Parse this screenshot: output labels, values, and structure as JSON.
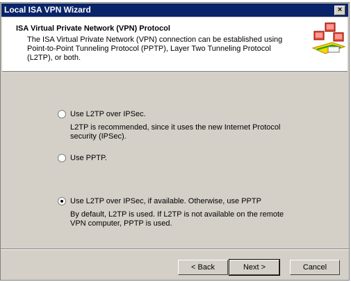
{
  "window": {
    "title": "Local ISA VPN Wizard",
    "close_glyph": "×"
  },
  "header": {
    "title": "ISA Virtual Private Network (VPN) Protocol",
    "description": "The ISA Virtual Private Network (VPN) connection can be established using Point-to-Point Tunneling Protocol (PPTP), Layer Two Tunneling Protocol (L2TP), or both.",
    "icon": "network-computers-icon"
  },
  "options": [
    {
      "label": "Use L2TP over IPSec.",
      "description": "L2TP is recommended, since it uses the new Internet Protocol security (IPSec).",
      "selected": false
    },
    {
      "label": "Use PPTP.",
      "description": "",
      "selected": false
    },
    {
      "label": "Use L2TP over IPSec, if available. Otherwise, use PPTP",
      "description": "By default, L2TP is used. If L2TP is not available on the remote VPN computer, PPTP is used.",
      "selected": true
    }
  ],
  "buttons": {
    "back": "< Back",
    "next": "Next >",
    "cancel": "Cancel"
  }
}
